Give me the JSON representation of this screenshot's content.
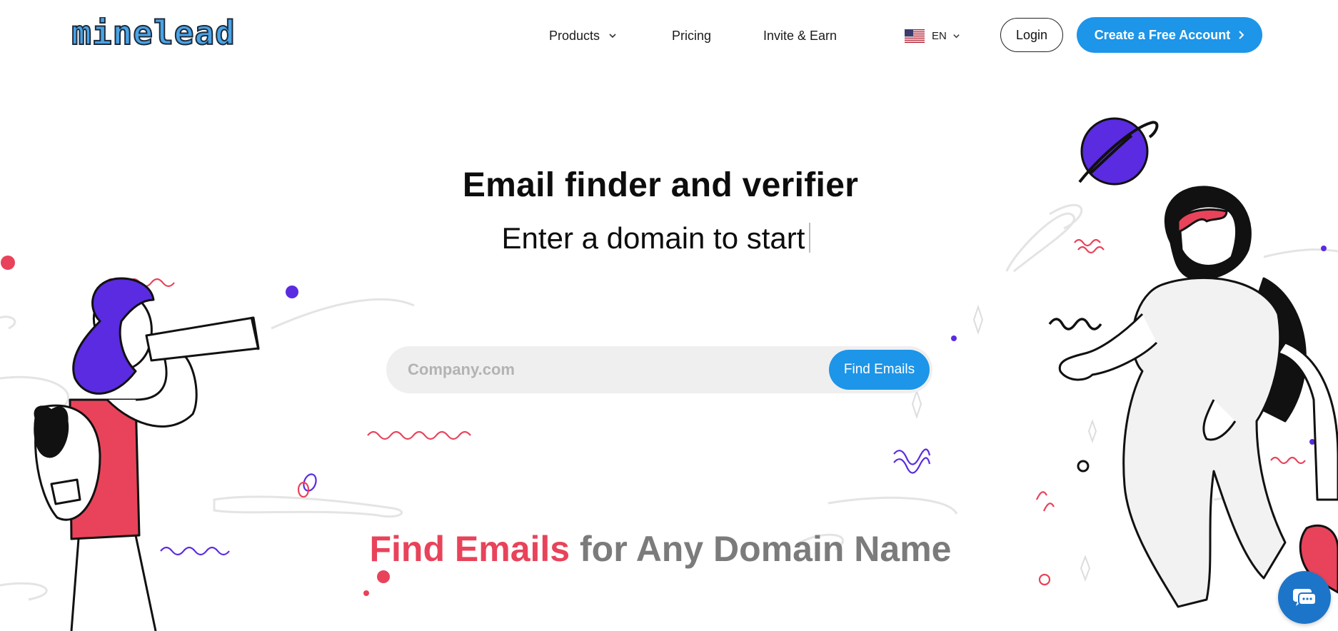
{
  "brand": {
    "logo_text": "minelead"
  },
  "nav": {
    "products": "Products",
    "pricing": "Pricing",
    "invite": "Invite & Earn",
    "language": "EN",
    "login": "Login",
    "create_account": "Create a Free Account"
  },
  "hero": {
    "title": "Email finder and verifier",
    "subtitle": "Enter a domain to start"
  },
  "search": {
    "placeholder": "Company.com",
    "value": "",
    "button": "Find Emails"
  },
  "headline": {
    "accent": "Find Emails",
    "rest": " for Any Domain Name"
  },
  "icons": [
    "chevron-down-icon",
    "us-flag-icon",
    "chevron-right-icon",
    "chat-icon"
  ],
  "colors": {
    "primary": "#1d95e8",
    "accent": "#e8435a",
    "purple": "#5a2be0",
    "headline_gray": "#7b7b7b"
  }
}
